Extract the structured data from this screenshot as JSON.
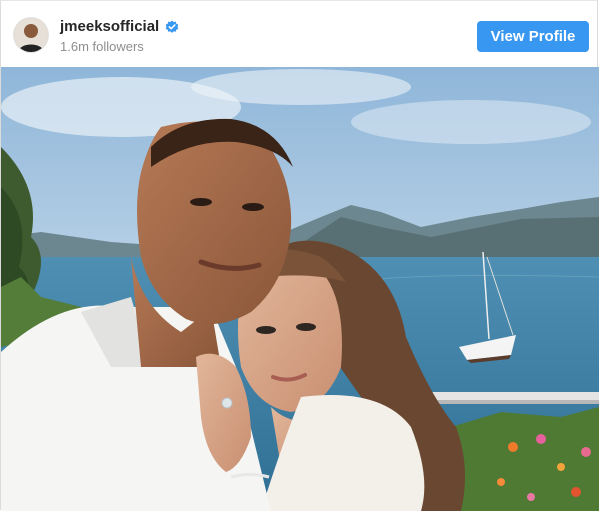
{
  "post": {
    "username": "jmeeksofficial",
    "followers": "1.6m followers",
    "verified": true,
    "view_profile_label": "View Profile"
  },
  "icons": {
    "verified": "verified-badge-icon"
  },
  "colors": {
    "button": "#3897f0",
    "verified_badge": "#3897f0",
    "username": "#262626",
    "secondary_text": "#8e8e8e"
  }
}
